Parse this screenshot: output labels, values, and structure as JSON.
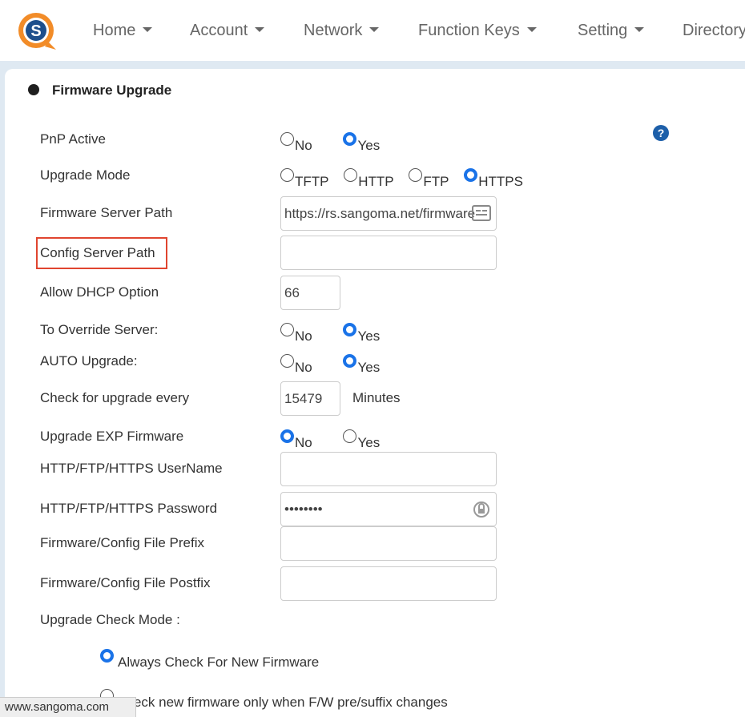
{
  "nav": {
    "items": [
      "Home",
      "Account",
      "Network",
      "Function Keys",
      "Setting",
      "Directory"
    ]
  },
  "section": {
    "title": "Firmware Upgrade",
    "help": "?"
  },
  "form": {
    "pnp_active": {
      "label": "PnP Active",
      "options": [
        "No",
        "Yes"
      ],
      "selected": "Yes"
    },
    "upgrade_mode": {
      "label": "Upgrade Mode",
      "options": [
        "TFTP",
        "HTTP",
        "FTP",
        "HTTPS"
      ],
      "selected": "HTTPS"
    },
    "firmware_server_path": {
      "label": "Firmware Server Path",
      "value": "https://rs.sangoma.net/firmware"
    },
    "config_server_path": {
      "label": "Config Server Path",
      "value": ""
    },
    "allow_dhcp_option": {
      "label": "Allow DHCP Option",
      "value": "66"
    },
    "override_server": {
      "label": "To Override Server:",
      "options": [
        "No",
        "Yes"
      ],
      "selected": "Yes"
    },
    "auto_upgrade": {
      "label": "AUTO Upgrade:",
      "options": [
        "No",
        "Yes"
      ],
      "selected": "Yes"
    },
    "check_every": {
      "label": "Check for upgrade every",
      "value": "15479",
      "units": "Minutes"
    },
    "upgrade_exp": {
      "label": "Upgrade EXP Firmware",
      "options": [
        "No",
        "Yes"
      ],
      "selected": "No"
    },
    "username": {
      "label": "HTTP/FTP/HTTPS UserName",
      "value": ""
    },
    "password": {
      "label": "HTTP/FTP/HTTPS Password",
      "value": "••••••••"
    },
    "file_prefix": {
      "label": "Firmware/Config File Prefix",
      "value": ""
    },
    "file_postfix": {
      "label": "Firmware/Config File Postfix",
      "value": ""
    },
    "check_mode": {
      "label": "Upgrade Check Mode :",
      "options": [
        "Always Check For New Firmware",
        "check new firmware only when F/W pre/suffix changes"
      ],
      "selected": "Always Check For New Firmware"
    }
  },
  "status_bar": {
    "text": "www.sangoma.com"
  },
  "colors": {
    "accent": "#1a73e8",
    "highlight": "#e0452f",
    "help": "#1d5fa9"
  }
}
